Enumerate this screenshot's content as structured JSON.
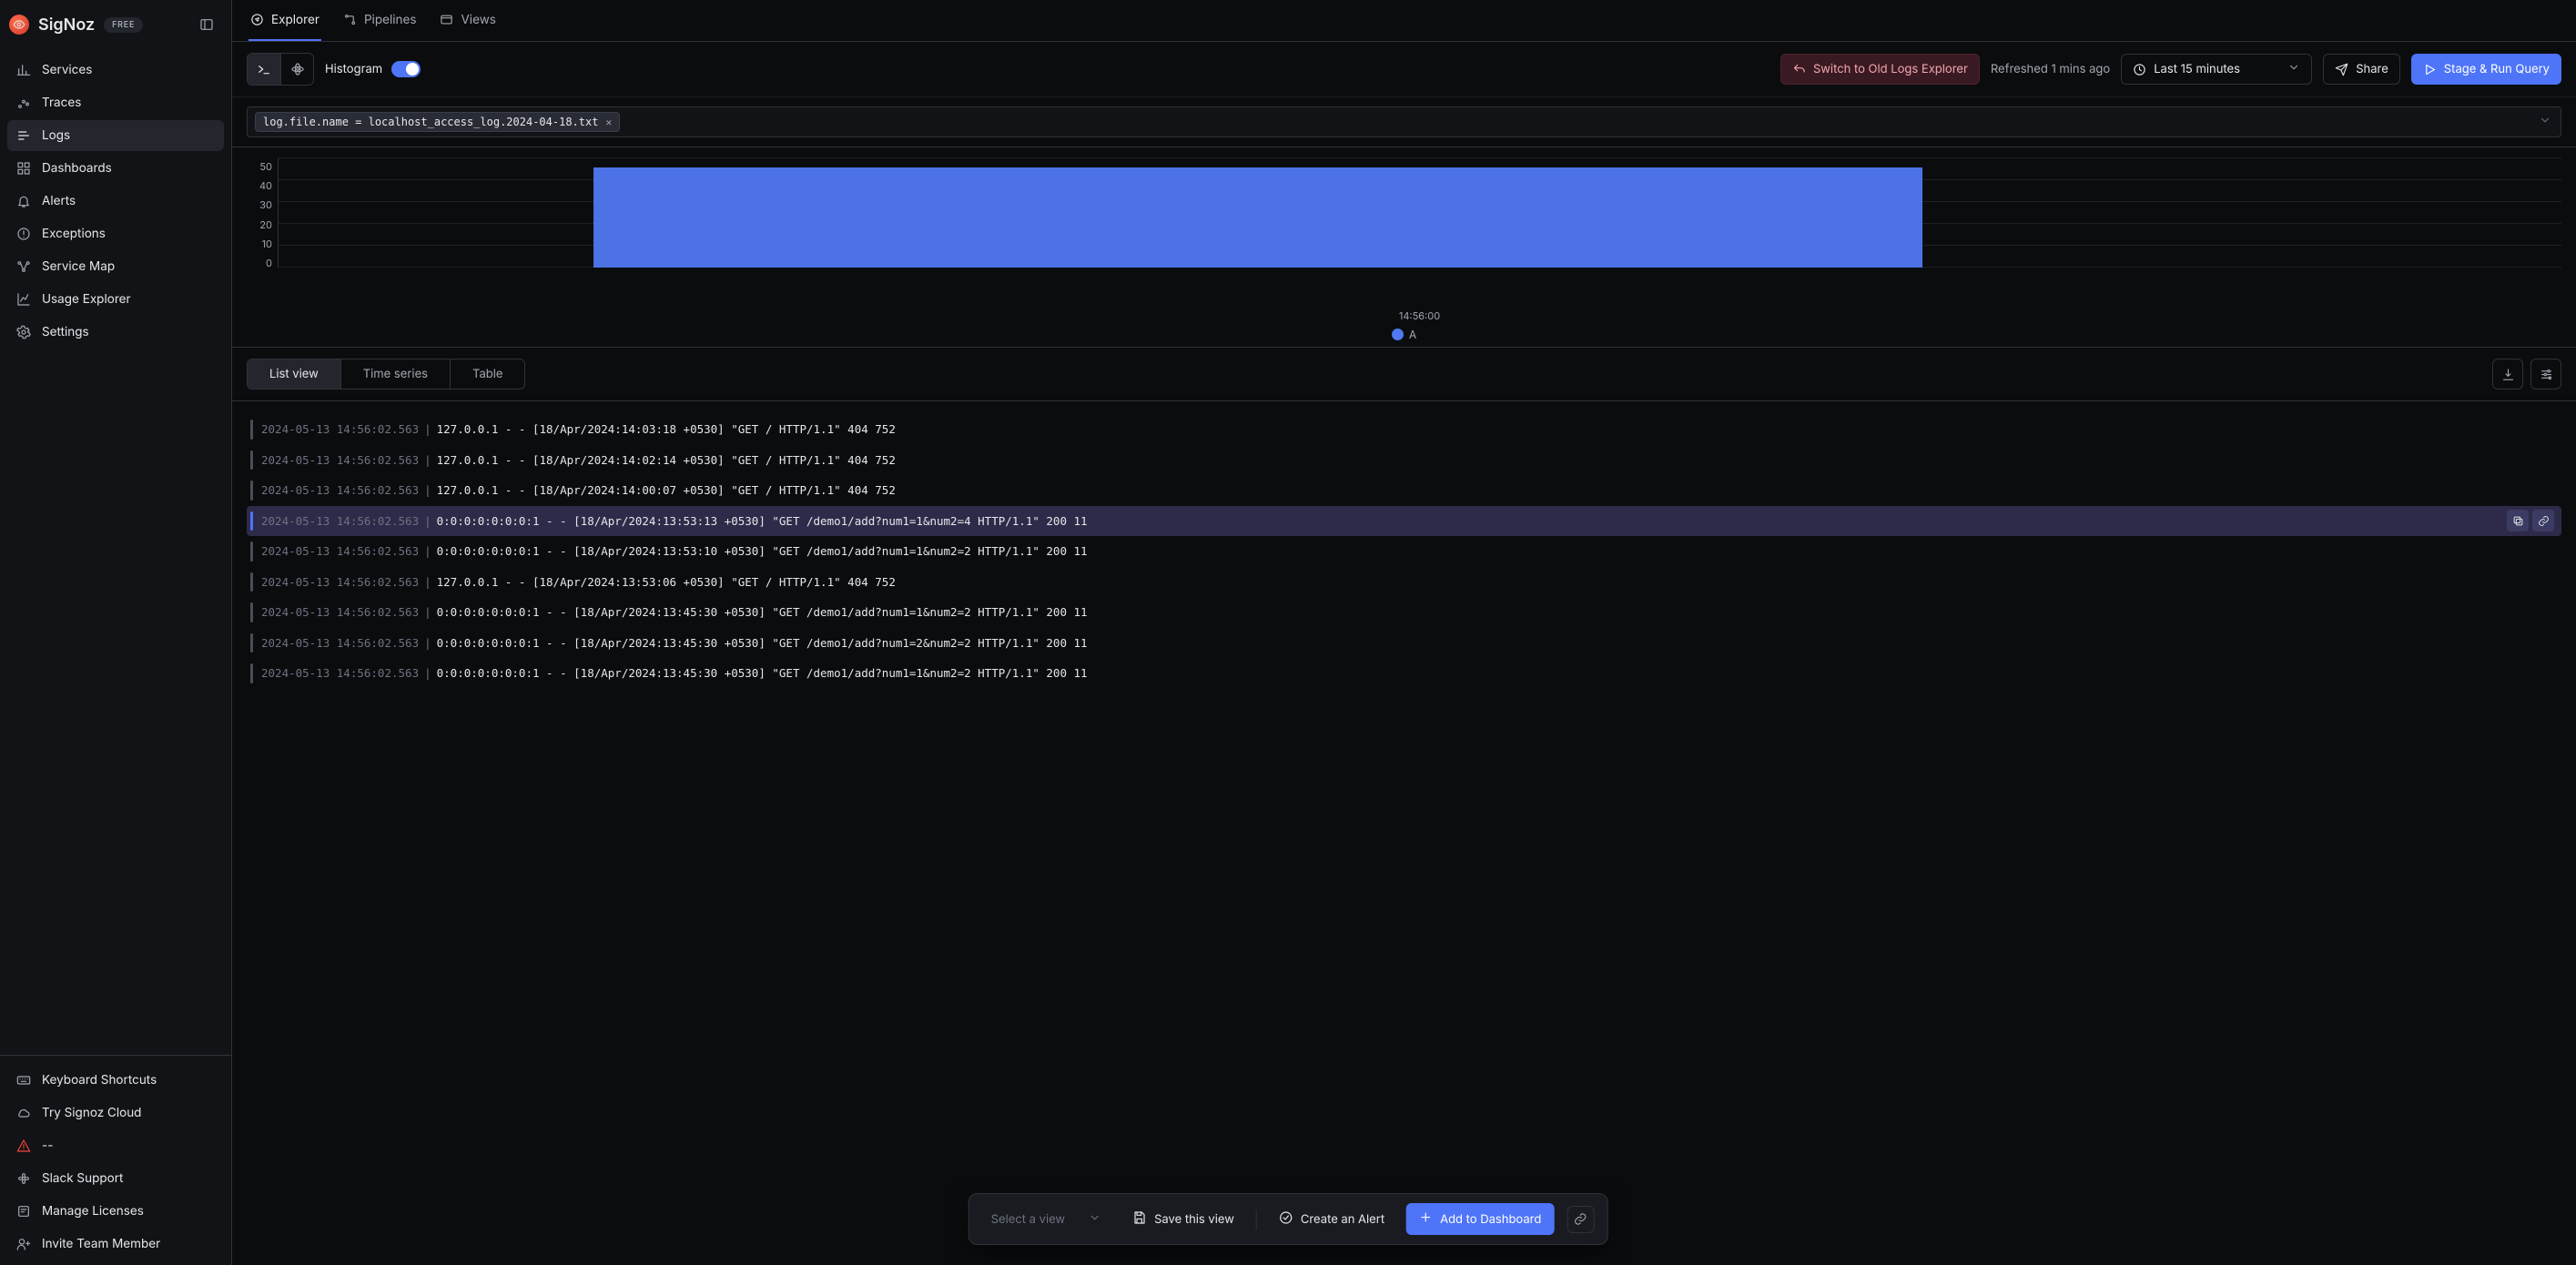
{
  "brand": {
    "name": "SigNoz",
    "badge": "FREE"
  },
  "sidebar": {
    "items": [
      {
        "label": "Services"
      },
      {
        "label": "Traces"
      },
      {
        "label": "Logs"
      },
      {
        "label": "Dashboards"
      },
      {
        "label": "Alerts"
      },
      {
        "label": "Exceptions"
      },
      {
        "label": "Service Map"
      },
      {
        "label": "Usage Explorer"
      },
      {
        "label": "Settings"
      }
    ],
    "footer": [
      {
        "label": "Keyboard Shortcuts"
      },
      {
        "label": "Try Signoz Cloud"
      },
      {
        "label": "--"
      },
      {
        "label": "Slack Support"
      },
      {
        "label": "Manage Licenses"
      },
      {
        "label": "Invite Team Member"
      }
    ]
  },
  "tabs": {
    "items": [
      {
        "label": "Explorer"
      },
      {
        "label": "Pipelines"
      },
      {
        "label": "Views"
      }
    ]
  },
  "toolbar": {
    "mode_label": "Histogram",
    "switch_label": "Switch to Old Logs Explorer",
    "refreshed": "Refreshed 1 mins ago",
    "time_range": "Last 15 minutes",
    "share": "Share",
    "stage_run": "Stage & Run Query"
  },
  "filter": {
    "chip": "log.file.name = localhost_access_log.2024-04-18.txt"
  },
  "chart_data": {
    "type": "bar",
    "categories": [
      "14:56:00"
    ],
    "values": [
      46
    ],
    "ylim": [
      0,
      50
    ],
    "yticks": [
      0,
      10,
      20,
      30,
      40,
      50
    ],
    "xlabel": "14:56:00",
    "legend": "A",
    "bar_left_pct": 13.8,
    "bar_width_pct": 58.2
  },
  "seg": {
    "list": "List view",
    "time_series": "Time series",
    "table": "Table"
  },
  "logs": [
    {
      "ts": "2024-05-13 14:56:02.563",
      "body": "127.0.0.1 - - [18/Apr/2024:14:03:18 +0530] \"GET / HTTP/1.1\" 404 752"
    },
    {
      "ts": "2024-05-13 14:56:02.563",
      "body": "127.0.0.1 - - [18/Apr/2024:14:02:14 +0530] \"GET / HTTP/1.1\" 404 752"
    },
    {
      "ts": "2024-05-13 14:56:02.563",
      "body": "127.0.0.1 - - [18/Apr/2024:14:00:07 +0530] \"GET / HTTP/1.1\" 404 752"
    },
    {
      "ts": "2024-05-13 14:56:02.563",
      "body": "0:0:0:0:0:0:0:1 - - [18/Apr/2024:13:53:13 +0530] \"GET /demo1/add?num1=1&num2=4 HTTP/1.1\" 200 11",
      "hi": true
    },
    {
      "ts": "2024-05-13 14:56:02.563",
      "body": "0:0:0:0:0:0:0:1 - - [18/Apr/2024:13:53:10 +0530] \"GET /demo1/add?num1=1&num2=2 HTTP/1.1\" 200 11"
    },
    {
      "ts": "2024-05-13 14:56:02.563",
      "body": "127.0.0.1 - - [18/Apr/2024:13:53:06 +0530] \"GET / HTTP/1.1\" 404 752"
    },
    {
      "ts": "2024-05-13 14:56:02.563",
      "body": "0:0:0:0:0:0:0:1 - - [18/Apr/2024:13:45:30 +0530] \"GET /demo1/add?num1=1&num2=2 HTTP/1.1\" 200 11"
    },
    {
      "ts": "2024-05-13 14:56:02.563",
      "body": "0:0:0:0:0:0:0:1 - - [18/Apr/2024:13:45:30 +0530] \"GET /demo1/add?num1=2&num2=2 HTTP/1.1\" 200 11"
    },
    {
      "ts": "2024-05-13 14:56:02.563",
      "body": "0:0:0:0:0:0:0:1 - - [18/Apr/2024:13:45:30 +0530] \"GET /demo1/add?num1=1&num2=2 HTTP/1.1\" 200 11"
    }
  ],
  "floatbar": {
    "select_placeholder": "Select a view",
    "save": "Save this view",
    "alert": "Create an Alert",
    "dashboard": "Add to Dashboard"
  }
}
